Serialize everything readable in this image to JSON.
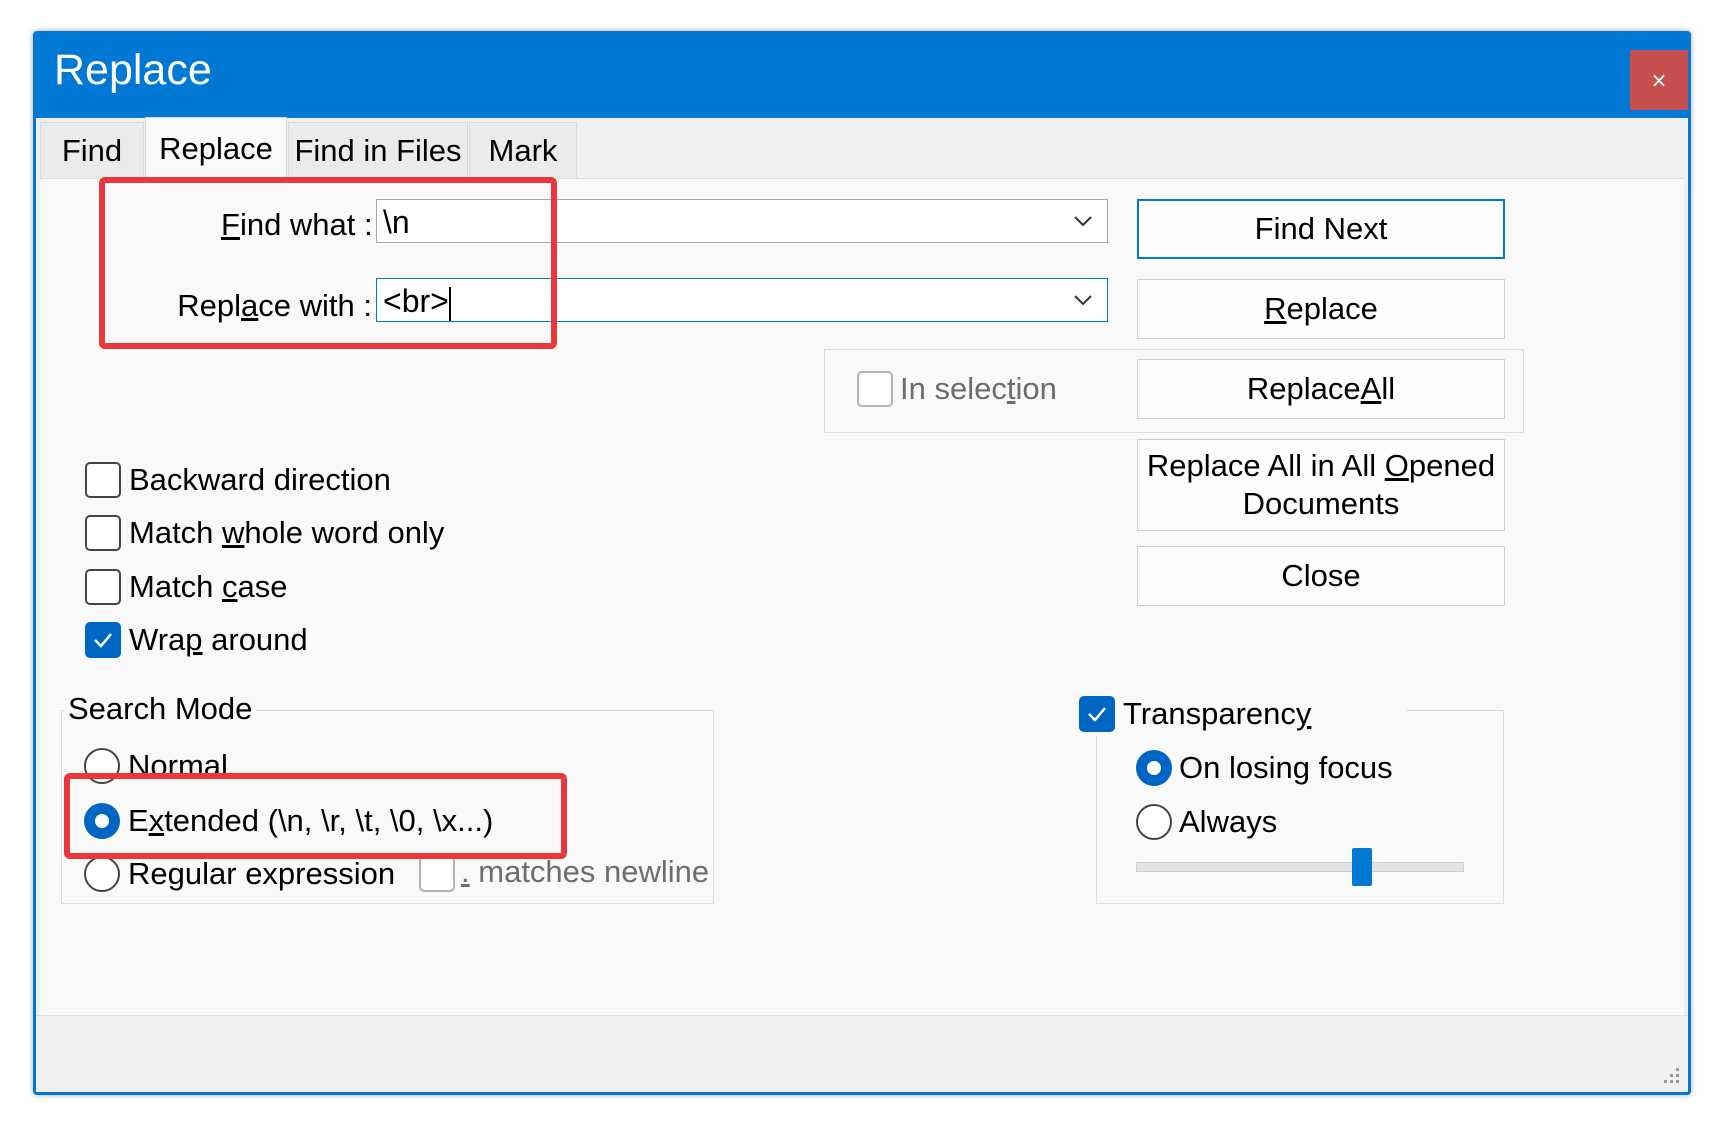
{
  "window": {
    "title": "Replace",
    "close_label": "×"
  },
  "tabs": [
    {
      "label": "Find",
      "active": false
    },
    {
      "label": "Replace",
      "active": true
    },
    {
      "label": "Find in Files",
      "active": false
    },
    {
      "label": "Mark",
      "active": false
    }
  ],
  "find_what": {
    "label": "Find what :",
    "value": "\\n"
  },
  "replace_with": {
    "label": "Replace with :",
    "value": "<br>"
  },
  "buttons": {
    "find_next": "Find Next",
    "replace": "Replace",
    "replace_all": "Replace All",
    "replace_all_opened_line1": "Replace All in All Opened",
    "replace_all_opened_line2": "Documents",
    "close": "Close"
  },
  "in_selection": {
    "label": "In selection",
    "checked": false,
    "enabled": false
  },
  "options": [
    {
      "label": "Backward direction",
      "checked": false
    },
    {
      "label": "Match whole word only",
      "checked": false
    },
    {
      "label": "Match case",
      "checked": false
    },
    {
      "label": "Wrap around",
      "checked": true
    }
  ],
  "search_mode": {
    "title": "Search Mode",
    "modes": [
      {
        "label": "Normal",
        "selected": false
      },
      {
        "label": "Extended (\\n, \\r, \\t, \\0, \\x...)",
        "selected": true
      },
      {
        "label": "Regular expression",
        "selected": false
      }
    ],
    "matches_newline": {
      "label": "matches newline",
      "prefix": ".",
      "checked": false,
      "enabled": false
    }
  },
  "transparency": {
    "label": "Transparency",
    "checked": true,
    "modes": [
      {
        "label": "On losing focus",
        "selected": true
      },
      {
        "label": "Always",
        "selected": false
      }
    ],
    "slider_level": 0.7
  },
  "colors": {
    "accent": "#0178d4",
    "checked": "#0066c3",
    "highlight": "#e8373d",
    "close_button": "#c74f4f"
  }
}
